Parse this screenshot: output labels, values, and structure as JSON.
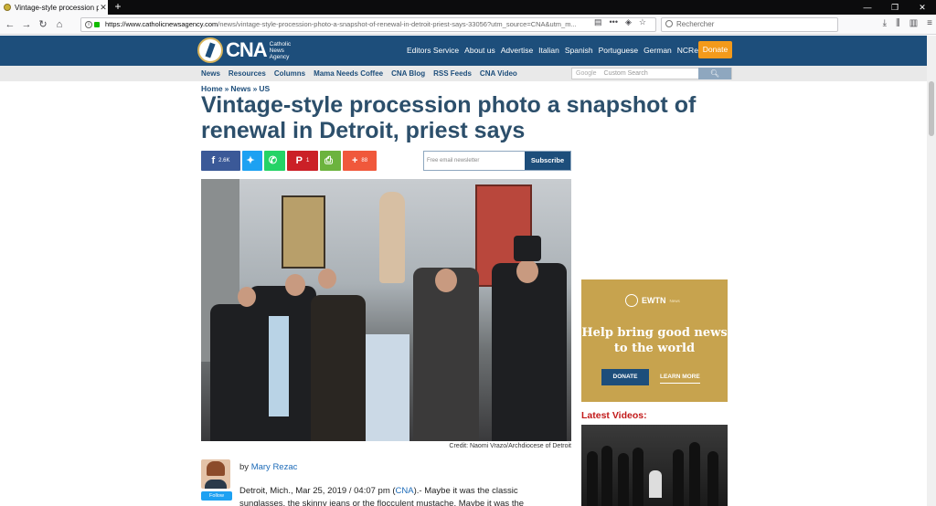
{
  "browser": {
    "tab_title": "Vintage-style procession photo",
    "url_host": "https://www.catholicnewsagency.com",
    "url_path": "/news/vintage-style-procession-photo-a-snapshot-of-renewal-in-detroit-priest-says-33056?utm_source=CNA&utm_m...",
    "search_placeholder": "Rechercher"
  },
  "site": {
    "logo_text": "CNA",
    "logo_sub": "Catholic News Agency",
    "top_nav": [
      "Editors Service",
      "About us",
      "Advertise",
      "Italian",
      "Spanish",
      "Portuguese",
      "German",
      "NCRegister"
    ],
    "donate_label": "Donate",
    "sec_nav": [
      "News",
      "Resources",
      "Columns",
      "Mama Needs Coffee",
      "CNA Blog",
      "RSS Feeds",
      "CNA Video"
    ],
    "google_label": "Google",
    "search_placeholder": "Custom Search"
  },
  "breadcrumb": [
    "Home",
    "News",
    "US"
  ],
  "article": {
    "title": "Vintage-style procession photo a snapshot of renewal in Detroit, priest says",
    "share": {
      "facebook_count": "2.6K",
      "pinterest_count": "1",
      "plus_count": "88"
    },
    "newsletter_placeholder": "Free email newsletter",
    "subscribe_label": "Subscribe",
    "photo_credit": "Credit: Naomi Vrazo/Archdiocese of Detroit",
    "by": "by",
    "author": "Mary Rezac",
    "follow_label": "Follow",
    "dateline": "Detroit, Mich., Mar 25, 2019 / 04:07 pm (",
    "dateline_link": "CNA",
    "body_start": ").- Maybe it was the classic sunglasses, the skinny jeans or the flocculent mustache. Maybe it was the"
  },
  "sidebar": {
    "ad_brand": "EWTN",
    "ad_brand_tag": "News",
    "ad_message": "Help bring good news to the world",
    "ad_donate": "DONATE",
    "ad_learn": "LEARN MORE",
    "latest_videos": "Latest Videos:"
  },
  "colors": {
    "header_blue": "#1d4e7b",
    "donate_orange": "#f39a1b",
    "headline": "#2c4f6b",
    "latest_red": "#c21a1a",
    "ad_gold": "#c7a34e"
  }
}
